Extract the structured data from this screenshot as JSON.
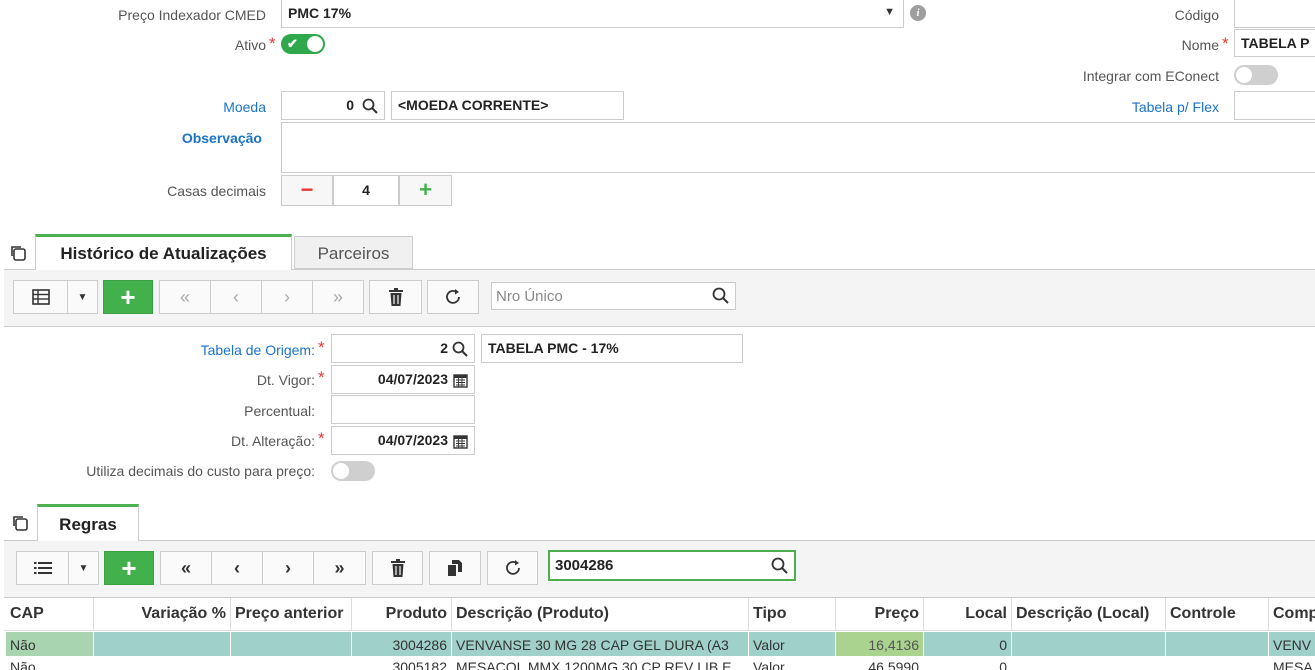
{
  "form": {
    "preco_indexador": {
      "label": "Preço Indexador CMED",
      "value": "PMC 17%"
    },
    "ativo": {
      "label": "Ativo",
      "on": true
    },
    "codigo": {
      "label": "Código",
      "value": ""
    },
    "nome": {
      "label": "Nome",
      "value": "TABELA P"
    },
    "integrar": {
      "label": "Integrar com EConect",
      "on": false
    },
    "moeda": {
      "label": "Moeda",
      "code": "0",
      "desc": "<MOEDA CORRENTE>"
    },
    "tabela_flex": {
      "label": "Tabela p/ Flex",
      "value": ""
    },
    "observacao": {
      "label": "Observação",
      "value": ""
    },
    "casas": {
      "label": "Casas decimais",
      "value": "4",
      "minus": "−",
      "plus": "+"
    }
  },
  "tabs": [
    {
      "label": "Histórico de Atualizações",
      "active": true
    },
    {
      "label": "Parceiros",
      "active": false
    }
  ],
  "hist_toolbar": {
    "search_placeholder": "Nro Único"
  },
  "hist": {
    "origem": {
      "label": "Tabela de Origem:",
      "code": "2",
      "desc": "TABELA PMC - 17%"
    },
    "vigor": {
      "label": "Dt. Vigor:",
      "value": "04/07/2023"
    },
    "percentual": {
      "label": "Percentual:",
      "value": ""
    },
    "alteracao": {
      "label": "Dt. Alteração:",
      "value": "04/07/2023"
    },
    "utiliza": {
      "label": "Utiliza decimais do custo para preço:",
      "on": false
    }
  },
  "regras_tab": {
    "label": "Regras"
  },
  "regras_toolbar": {
    "search_value": "3004286"
  },
  "grid": {
    "columns": [
      "CAP",
      "Variação %",
      "Preço anterior",
      "Produto",
      "Descrição (Produto)",
      "Tipo",
      "Preço",
      "Local",
      "Descrição (Local)",
      "Controle",
      "Comp"
    ],
    "rows": [
      [
        "Não",
        "",
        "",
        "3004286",
        "VENVANSE 30 MG 28 CAP GEL DURA (A3",
        "Valor",
        "16,4136",
        "0",
        "",
        "",
        "VENV"
      ],
      [
        "Não",
        "",
        "",
        "3005182",
        "MESACOL MMX 1200MG 30 CP REV LIB E",
        "Valor",
        "46,5990",
        "0",
        "",
        "",
        "MESA"
      ]
    ]
  },
  "colors": {
    "accent": "#43b14b",
    "link": "#1a73c9",
    "required": "#e53935",
    "row_selected": "#9fd1c9"
  }
}
